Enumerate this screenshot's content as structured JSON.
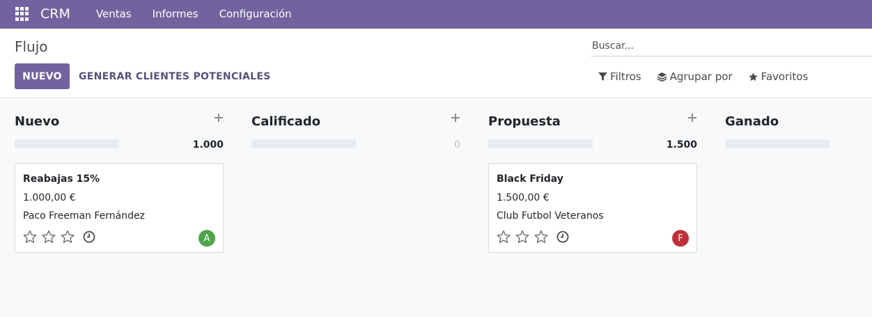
{
  "navbar": {
    "apps_icon": "apps-grid-icon",
    "brand": "CRM",
    "menu": [
      "Ventas",
      "Informes",
      "Configuración"
    ]
  },
  "control_panel": {
    "breadcrumb": "Flujo",
    "new_button": "NUEVO",
    "generate_button": "GENERAR CLIENTES POTENCIALES",
    "search_placeholder": "Buscar...",
    "filters": [
      {
        "label": "Filtros",
        "icon": "filter-icon"
      },
      {
        "label": "Agrupar por",
        "icon": "layers-icon"
      },
      {
        "label": "Favoritos",
        "icon": "star-icon"
      }
    ]
  },
  "kanban": {
    "columns": [
      {
        "title": "Nuevo",
        "total": "1.000"
      },
      {
        "title": "Calificado",
        "total": "0"
      },
      {
        "title": "Propuesta",
        "total": "1.500"
      },
      {
        "title": "Ganado",
        "total": ""
      }
    ],
    "cards": [
      {
        "title": "Reabajas 15%",
        "amount": "1.000,00 €",
        "partner": "Paco Freeman Fernández",
        "avatar": "A",
        "avatar_color": "#4fa64a"
      },
      {
        "title": "Black Friday",
        "amount": "1.500,00 €",
        "partner": "Club Futbol Veteranos",
        "avatar": "F",
        "avatar_color": "#c0303b"
      }
    ]
  },
  "colors": {
    "primary": "#71639e",
    "navbar_text": "#ffffff"
  }
}
